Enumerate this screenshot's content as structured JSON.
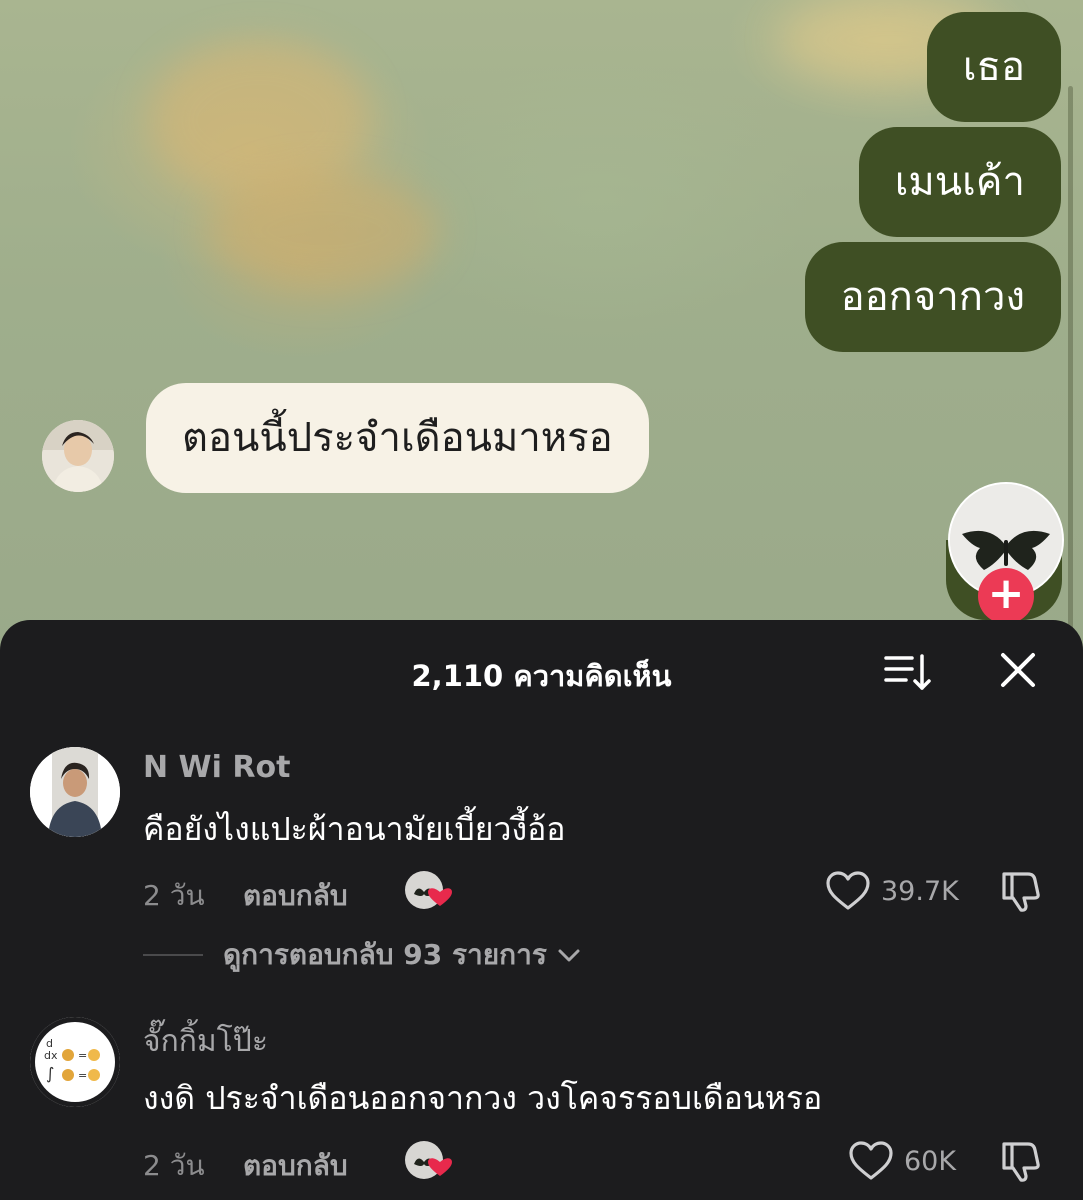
{
  "video": {
    "messages_right": [
      "เธอ",
      "เมนเค้า",
      "ออกจากวง"
    ],
    "message_left": "ตอนนี้ประจำเดือนมาหรอ",
    "follow_label": "+"
  },
  "comments_sheet": {
    "title": "2,110 ความคิดเห็น",
    "sort_icon": "sort-icon",
    "close_icon": "close-icon",
    "comments": [
      {
        "username": "N Wi Rot",
        "text": "คือยังไงแปะผ้าอนามัยเบี้ยวงี้อ้อ",
        "time": "2 วัน",
        "reply_label": "ตอบกลับ",
        "like_count": "39.7K",
        "view_replies": "ดูการตอบกลับ 93 รายการ"
      },
      {
        "username": "จั๊กกิ้มโป๊ะ",
        "text": "งงดิ ประจำเดือนออกจากวง วงโคจรรอบเดือนหรอ",
        "time": "2 วัน",
        "reply_label": "ตอบกลับ",
        "like_count": "60K"
      }
    ]
  },
  "colors": {
    "sheet_bg": "#1c1c1e",
    "bubble_dark": "#3f4f24",
    "bubble_light": "#f7f2e6",
    "follow_red": "#ec3a55",
    "like_heart_red": "#e8294c"
  }
}
